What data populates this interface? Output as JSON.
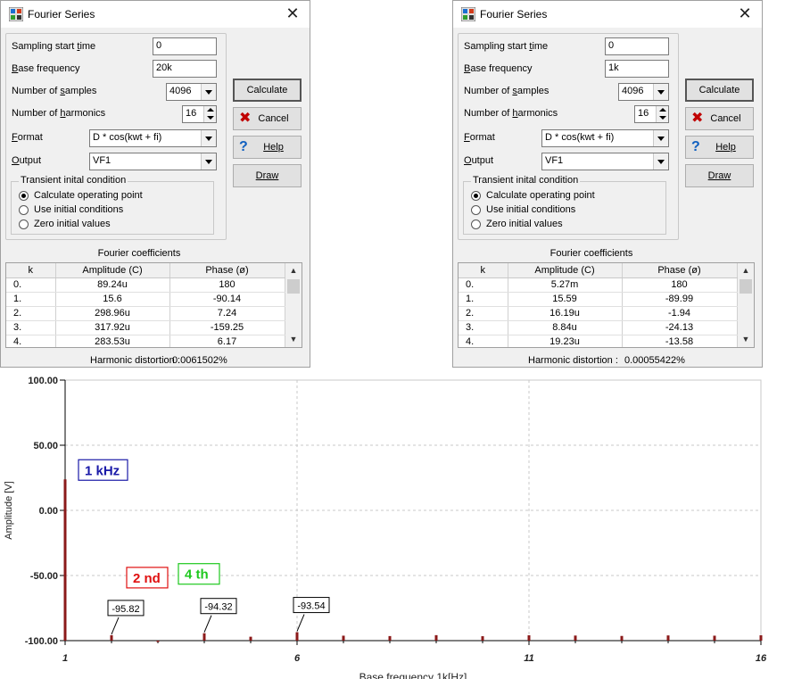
{
  "dialogs": [
    {
      "title": "Fourier Series",
      "close_glyph": "✕",
      "labels": {
        "start_pre": "Sampling start ",
        "start_u": "t",
        "start_post": "ime",
        "base_u": "B",
        "base_post": "ase frequency",
        "samples_pre": "Number of ",
        "samples_u": "s",
        "samples_post": "amples",
        "harm_pre": "Number of ",
        "harm_u": "h",
        "harm_post": "armonics",
        "format_u": "F",
        "format_post": "ormat",
        "output_u": "O",
        "output_post": "utput"
      },
      "sampling_start_time": "0",
      "base_frequency": "20k",
      "number_of_samples": "4096",
      "number_of_harmonics": "16",
      "format": "D * cos(kwt + fi)",
      "output": "VF1",
      "transient_title": "Transient inital condition",
      "radios": [
        {
          "label": "Calculate operating point",
          "checked": true
        },
        {
          "label": "Use initial conditions",
          "checked": false
        },
        {
          "label": "Zero initial values",
          "checked": false
        }
      ],
      "buttons": {
        "calculate": "Calculate",
        "cancel": "Cancel",
        "help": "Help",
        "draw": "Draw",
        "cancel_icon": "✖",
        "help_icon": "?"
      },
      "coef_title": "Fourier coefficients",
      "table": {
        "headers": [
          "k",
          "Amplitude (C)",
          "Phase (ø)"
        ],
        "rows": [
          [
            "0.",
            "89.24u",
            "180"
          ],
          [
            "1.",
            "15.6",
            "-90.14"
          ],
          [
            "2.",
            "298.96u",
            "7.24"
          ],
          [
            "3.",
            "317.92u",
            "-159.25"
          ],
          [
            "4.",
            "283.53u",
            "6.17"
          ]
        ]
      },
      "distortion_label": "Harmonic distortion :",
      "distortion_value": "0.0061502%"
    },
    {
      "title": "Fourier Series",
      "close_glyph": "✕",
      "labels": {
        "start_pre": "Sampling start ",
        "start_u": "t",
        "start_post": "ime",
        "base_u": "B",
        "base_post": "ase frequency",
        "samples_pre": "Number of ",
        "samples_u": "s",
        "samples_post": "amples",
        "harm_pre": "Number of ",
        "harm_u": "h",
        "harm_post": "armonics",
        "format_u": "F",
        "format_post": "ormat",
        "output_u": "O",
        "output_post": "utput"
      },
      "sampling_start_time": "0",
      "base_frequency": "1k",
      "number_of_samples": "4096",
      "number_of_harmonics": "16",
      "format": "D * cos(kwt + fi)",
      "output": "VF1",
      "transient_title": "Transient inital condition",
      "radios": [
        {
          "label": "Calculate operating point",
          "checked": true
        },
        {
          "label": "Use initial conditions",
          "checked": false
        },
        {
          "label": "Zero initial values",
          "checked": false
        }
      ],
      "buttons": {
        "calculate": "Calculate",
        "cancel": "Cancel",
        "help": "Help",
        "draw": "Draw",
        "cancel_icon": "✖",
        "help_icon": "?"
      },
      "coef_title": "Fourier coefficients",
      "table": {
        "headers": [
          "k",
          "Amplitude (C)",
          "Phase (ø)"
        ],
        "rows": [
          [
            "0.",
            "5.27m",
            "180"
          ],
          [
            "1.",
            "15.59",
            "-89.99"
          ],
          [
            "2.",
            "16.19u",
            "-1.94"
          ],
          [
            "3.",
            "8.84u",
            "-24.13"
          ],
          [
            "4.",
            "19.23u",
            "-13.58"
          ]
        ]
      },
      "distortion_label": "Harmonic distortion :",
      "distortion_value": "0.00055422%"
    }
  ],
  "chart_data": {
    "type": "bar",
    "xlabel": "Base frequency 1k[Hz]",
    "ylabel": "Amplitude [V]",
    "xlim": [
      1,
      16
    ],
    "ylim": [
      -100,
      100
    ],
    "x_ticks": [
      "1",
      "6",
      "11",
      "16"
    ],
    "y_ticks": [
      "100.00",
      "50.00",
      "0.00",
      "-50.00",
      "-100.00"
    ],
    "grid": true,
    "bar_color": "#8b1a1a",
    "x": [
      1,
      2,
      3,
      4,
      5,
      6,
      7,
      8,
      9,
      10,
      11,
      12,
      13,
      14,
      15,
      16
    ],
    "values": [
      23.8,
      -95.82,
      -100,
      -94.32,
      -97.0,
      -93.54,
      -96.2,
      -96.5,
      -95.8,
      -96.6,
      -95.9,
      -96.1,
      -96.4,
      -96.0,
      -96.2,
      -95.9
    ],
    "annotations": [
      {
        "text": "1 kHz",
        "color": "#1a1aa8"
      },
      {
        "text": "2 nd",
        "color": "#e01010"
      },
      {
        "text": "4 th",
        "color": "#1ec81e"
      }
    ],
    "value_labels": [
      {
        "x": 2,
        "text": "-95.82"
      },
      {
        "x": 4,
        "text": "-94.32"
      },
      {
        "x": 6,
        "text": "-93.54"
      }
    ]
  }
}
